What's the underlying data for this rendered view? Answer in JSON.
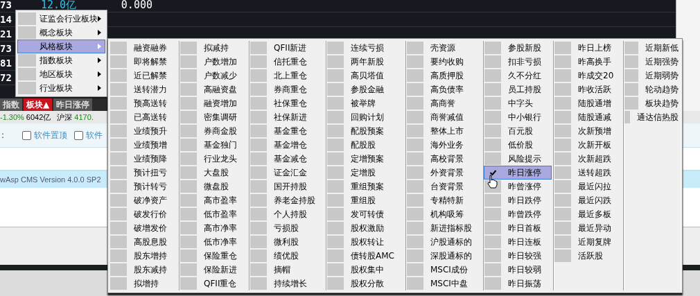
{
  "table": {
    "rows": [
      {
        "cells": [
          "73",
          "12.0亿",
          "0.000"
        ]
      },
      {
        "cells": [
          "14"
        ]
      },
      {
        "cells": [
          "21"
        ]
      },
      {
        "cells": [
          "73"
        ]
      },
      {
        "cells": [
          "81"
        ]
      },
      {
        "cells": [
          "72"
        ]
      }
    ]
  },
  "tabs": [
    {
      "label": "指数",
      "selected": false
    },
    {
      "label": "板块▲",
      "selected": true
    },
    {
      "label": "昨日涨停",
      "selected": false
    }
  ],
  "status": {
    "change": "-1.30%",
    "volume": "6042亿",
    "market": "沪深",
    "index": "4170."
  },
  "web": {
    "prefix": ":",
    "checkboxes": [
      {
        "label": "软件置顶",
        "checked": false
      },
      {
        "label": "软件",
        "checked": false
      }
    ],
    "footer": "wAsp CMS Version 4.0.0 SP2"
  },
  "menu": {
    "items": [
      {
        "label": "证监会行业板块",
        "selected": false
      },
      {
        "label": "概念板块",
        "selected": false
      },
      {
        "label": "风格板块",
        "selected": true
      },
      {
        "label": "指数板块",
        "selected": false
      },
      {
        "label": "地区板块",
        "selected": false
      },
      {
        "label": "行业板块",
        "selected": false
      }
    ]
  },
  "submenu": {
    "columns": [
      {
        "items": [
          {
            "label": "融资融券",
            "selected": false,
            "checked": false
          },
          {
            "label": "即将解禁",
            "selected": false,
            "checked": false
          },
          {
            "label": "近已解禁",
            "selected": false,
            "checked": false
          },
          {
            "label": "送转潜力",
            "selected": false,
            "checked": false
          },
          {
            "label": "预高送转",
            "selected": false,
            "checked": false
          },
          {
            "label": "已高送转",
            "selected": false,
            "checked": false
          },
          {
            "label": "业绩预升",
            "selected": false,
            "checked": false
          },
          {
            "label": "业绩预增",
            "selected": false,
            "checked": false
          },
          {
            "label": "业绩预降",
            "selected": false,
            "checked": false
          },
          {
            "label": "预计扭亏",
            "selected": false,
            "checked": false
          },
          {
            "label": "预计转亏",
            "selected": false,
            "checked": false
          },
          {
            "label": "破净资产",
            "selected": false,
            "checked": false
          },
          {
            "label": "破发行价",
            "selected": false,
            "checked": false
          },
          {
            "label": "破增发价",
            "selected": false,
            "checked": false
          },
          {
            "label": "高股息股",
            "selected": false,
            "checked": false
          },
          {
            "label": "股东增持",
            "selected": false,
            "checked": false
          },
          {
            "label": "股东减持",
            "selected": false,
            "checked": false
          },
          {
            "label": "拟增持",
            "selected": false,
            "checked": false
          }
        ]
      },
      {
        "items": [
          {
            "label": "拟减持",
            "selected": false,
            "checked": false
          },
          {
            "label": "户数增加",
            "selected": false,
            "checked": false
          },
          {
            "label": "户数减少",
            "selected": false,
            "checked": false
          },
          {
            "label": "高融资盘",
            "selected": false,
            "checked": false
          },
          {
            "label": "融资增加",
            "selected": false,
            "checked": false
          },
          {
            "label": "密集调研",
            "selected": false,
            "checked": false
          },
          {
            "label": "券商金股",
            "selected": false,
            "checked": false
          },
          {
            "label": "基金独门",
            "selected": false,
            "checked": false
          },
          {
            "label": "行业龙头",
            "selected": false,
            "checked": false
          },
          {
            "label": "大盘股",
            "selected": false,
            "checked": false
          },
          {
            "label": "微盘股",
            "selected": false,
            "checked": false
          },
          {
            "label": "高市盈率",
            "selected": false,
            "checked": false
          },
          {
            "label": "低市盈率",
            "selected": false,
            "checked": false
          },
          {
            "label": "高市净率",
            "selected": false,
            "checked": false
          },
          {
            "label": "低市净率",
            "selected": false,
            "checked": false
          },
          {
            "label": "保险重仓",
            "selected": false,
            "checked": false
          },
          {
            "label": "保险新进",
            "selected": false,
            "checked": false
          },
          {
            "label": "QFII重仓",
            "selected": false,
            "checked": false
          }
        ]
      },
      {
        "items": [
          {
            "label": "QFII新进",
            "selected": false,
            "checked": false
          },
          {
            "label": "信托重仓",
            "selected": false,
            "checked": false
          },
          {
            "label": "北上重仓",
            "selected": false,
            "checked": false
          },
          {
            "label": "券商重仓",
            "selected": false,
            "checked": false
          },
          {
            "label": "社保重仓",
            "selected": false,
            "checked": false
          },
          {
            "label": "社保新进",
            "selected": false,
            "checked": false
          },
          {
            "label": "基金重仓",
            "selected": false,
            "checked": false
          },
          {
            "label": "基金增仓",
            "selected": false,
            "checked": false
          },
          {
            "label": "基金减仓",
            "selected": false,
            "checked": false
          },
          {
            "label": "证金汇金",
            "selected": false,
            "checked": false
          },
          {
            "label": "国开持股",
            "selected": false,
            "checked": false
          },
          {
            "label": "养老金持股",
            "selected": false,
            "checked": false
          },
          {
            "label": "个人持股",
            "selected": false,
            "checked": false
          },
          {
            "label": "亏损股",
            "selected": false,
            "checked": false
          },
          {
            "label": "微利股",
            "selected": false,
            "checked": false
          },
          {
            "label": "绩优股",
            "selected": false,
            "checked": false
          },
          {
            "label": "摘帽",
            "selected": false,
            "checked": false
          },
          {
            "label": "持续增长",
            "selected": false,
            "checked": false
          }
        ]
      },
      {
        "items": [
          {
            "label": "连续亏损",
            "selected": false,
            "checked": false
          },
          {
            "label": "两年新股",
            "selected": false,
            "checked": false
          },
          {
            "label": "高贝塔值",
            "selected": false,
            "checked": false
          },
          {
            "label": "参股金融",
            "selected": false,
            "checked": false
          },
          {
            "label": "被举牌",
            "selected": false,
            "checked": false
          },
          {
            "label": "回购计划",
            "selected": false,
            "checked": false
          },
          {
            "label": "配股预案",
            "selected": false,
            "checked": false
          },
          {
            "label": "配股股",
            "selected": false,
            "checked": false
          },
          {
            "label": "定增预案",
            "selected": false,
            "checked": false
          },
          {
            "label": "定增股",
            "selected": false,
            "checked": false
          },
          {
            "label": "重组预案",
            "selected": false,
            "checked": false
          },
          {
            "label": "重组股",
            "selected": false,
            "checked": false
          },
          {
            "label": "发可转债",
            "selected": false,
            "checked": false
          },
          {
            "label": "股权激励",
            "selected": false,
            "checked": false
          },
          {
            "label": "股权转让",
            "selected": false,
            "checked": false
          },
          {
            "label": "债转股AMC",
            "selected": false,
            "checked": false
          },
          {
            "label": "股权集中",
            "selected": false,
            "checked": false
          },
          {
            "label": "股权分散",
            "selected": false,
            "checked": false
          }
        ]
      },
      {
        "items": [
          {
            "label": "壳资源",
            "selected": false,
            "checked": false
          },
          {
            "label": "要约收购",
            "selected": false,
            "checked": false
          },
          {
            "label": "高质押股",
            "selected": false,
            "checked": false
          },
          {
            "label": "高负债率",
            "selected": false,
            "checked": false
          },
          {
            "label": "高商誉",
            "selected": false,
            "checked": false
          },
          {
            "label": "商誉减值",
            "selected": false,
            "checked": false
          },
          {
            "label": "整体上市",
            "selected": false,
            "checked": false
          },
          {
            "label": "海外业务",
            "selected": false,
            "checked": false
          },
          {
            "label": "高校背景",
            "selected": false,
            "checked": false
          },
          {
            "label": "外资背景",
            "selected": false,
            "checked": false
          },
          {
            "label": "台资背景",
            "selected": false,
            "checked": false
          },
          {
            "label": "专精特新",
            "selected": false,
            "checked": false
          },
          {
            "label": "机构吸筹",
            "selected": false,
            "checked": false
          },
          {
            "label": "新进指标股",
            "selected": false,
            "checked": false
          },
          {
            "label": "沪股通标的",
            "selected": false,
            "checked": false
          },
          {
            "label": "深股通标的",
            "selected": false,
            "checked": false
          },
          {
            "label": "MSCI成份",
            "selected": false,
            "checked": false
          },
          {
            "label": "MSCI中盘",
            "selected": false,
            "checked": false
          }
        ]
      },
      {
        "items": [
          {
            "label": "参股新股",
            "selected": false,
            "checked": false
          },
          {
            "label": "扣非亏损",
            "selected": false,
            "checked": false
          },
          {
            "label": "久不分红",
            "selected": false,
            "checked": false
          },
          {
            "label": "员工持股",
            "selected": false,
            "checked": false
          },
          {
            "label": "中字头",
            "selected": false,
            "checked": false
          },
          {
            "label": "中小银行",
            "selected": false,
            "checked": false
          },
          {
            "label": "百元股",
            "selected": false,
            "checked": false
          },
          {
            "label": "低价股",
            "selected": false,
            "checked": false
          },
          {
            "label": "风险提示",
            "selected": false,
            "checked": false
          },
          {
            "label": "昨日涨停",
            "selected": true,
            "checked": true
          },
          {
            "label": "昨曾涨停",
            "selected": false,
            "checked": false
          },
          {
            "label": "昨日跌停",
            "selected": false,
            "checked": false
          },
          {
            "label": "昨曾跌停",
            "selected": false,
            "checked": false
          },
          {
            "label": "昨日首板",
            "selected": false,
            "checked": false
          },
          {
            "label": "昨日连板",
            "selected": false,
            "checked": false
          },
          {
            "label": "昨日较强",
            "selected": false,
            "checked": false
          },
          {
            "label": "昨日较弱",
            "selected": false,
            "checked": false
          },
          {
            "label": "昨日振荡",
            "selected": false,
            "checked": false
          }
        ]
      },
      {
        "items": [
          {
            "label": "昨日上榜",
            "selected": false,
            "checked": false
          },
          {
            "label": "昨高换手",
            "selected": false,
            "checked": false
          },
          {
            "label": "昨成交20",
            "selected": false,
            "checked": false
          },
          {
            "label": "昨收活跃",
            "selected": false,
            "checked": false
          },
          {
            "label": "陆股通增",
            "selected": false,
            "checked": false
          },
          {
            "label": "陆股通减",
            "selected": false,
            "checked": false
          },
          {
            "label": "次新预增",
            "selected": false,
            "checked": false
          },
          {
            "label": "次新开板",
            "selected": false,
            "checked": false
          },
          {
            "label": "次新超跌",
            "selected": false,
            "checked": false
          },
          {
            "label": "送转超跌",
            "selected": false,
            "checked": false
          },
          {
            "label": "最近闪拉",
            "selected": false,
            "checked": false
          },
          {
            "label": "最近闪跌",
            "selected": false,
            "checked": false
          },
          {
            "label": "最近多板",
            "selected": false,
            "checked": false
          },
          {
            "label": "最近异动",
            "selected": false,
            "checked": false
          },
          {
            "label": "近期复牌",
            "selected": false,
            "checked": false
          },
          {
            "label": "活跃股",
            "selected": false,
            "checked": false
          }
        ]
      },
      {
        "items": [
          {
            "label": "近期新低",
            "selected": false,
            "checked": false
          },
          {
            "label": "近期强势",
            "selected": false,
            "checked": false
          },
          {
            "label": "近期弱势",
            "selected": false,
            "checked": false
          },
          {
            "label": "轮动趋势",
            "selected": false,
            "checked": false
          },
          {
            "label": "板块趋势",
            "selected": false,
            "checked": false
          },
          {
            "label": "通达信热股",
            "selected": false,
            "checked": false
          }
        ]
      }
    ]
  }
}
